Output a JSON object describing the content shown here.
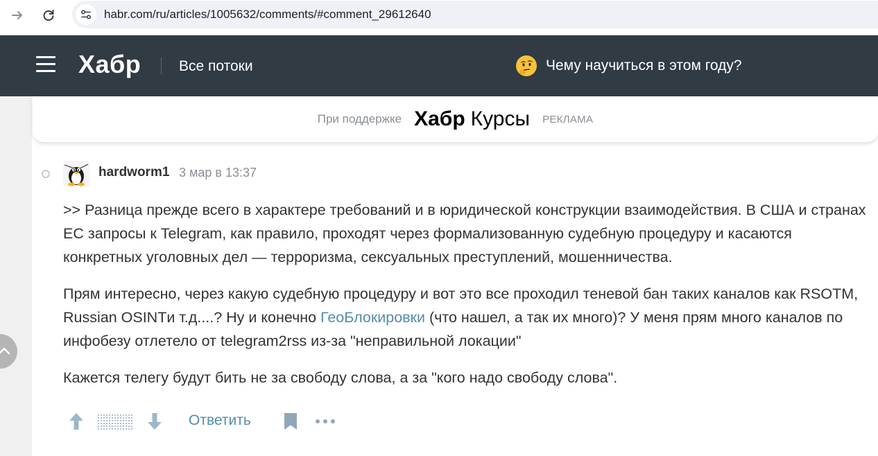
{
  "browser": {
    "url": "habr.com/ru/articles/1005632/comments/#comment_29612640"
  },
  "header": {
    "logo": "Хабр",
    "all_flows": "Все потоки",
    "promo_text": "Чему научиться в этом году?"
  },
  "sponsor": {
    "label": "При поддержке",
    "brand_bold": "Хабр",
    "brand_light": "Курсы",
    "ad_label": "РЕКЛАМА"
  },
  "comment": {
    "author": "hardworm1",
    "date": "3 мар в 13:37",
    "paragraph1": ">> Разница прежде всего в характере требований и в юридической конструкции взаимодействия. В США и странах ЕС запросы к Telegram, как правило, проходят через формализованную судебную процедуру и касаются конкретных уголовных дел — терроризма, сексуальных преступлений, мошенничества.",
    "paragraph2_part1": "Прям интересно, через какую судебную процедуру и вот это все проходил теневой бан таких каналов как RSOTM, Russian OSINTи т.д....? Ну и конечно ",
    "paragraph2_link": "ГеоБлокировки",
    "paragraph2_part2": " (что нашел, а так их много)? У меня прям много каналов по инфобезу отлетело от telegram2rss из-за \"неправильной локации\"",
    "paragraph3": "Кажется телегу будут бить не за свободу слова, а за \"кого надо свободу слова\".",
    "reply_label": "Ответить"
  },
  "colors": {
    "header_bg": "#303b44",
    "link": "#548eaa",
    "text": "#333333",
    "muted": "#8a8f94"
  },
  "icons": [
    "forward-arrow-icon",
    "reload-icon",
    "site-settings-icon",
    "menu-icon",
    "thinking-emoji-icon",
    "upvote-arrow-icon",
    "downvote-arrow-icon",
    "bookmark-icon",
    "more-options-icon",
    "scroll-up-icon"
  ]
}
